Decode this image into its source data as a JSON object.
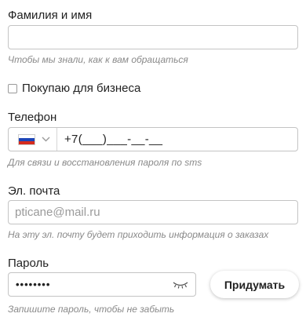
{
  "name_field": {
    "label": "Фамилия и имя",
    "value": "",
    "placeholder": "",
    "hint": "Чтобы мы знали, как к вам обращаться"
  },
  "business_checkbox": {
    "label": "Покупаю для бизнеса",
    "checked": false
  },
  "phone_field": {
    "label": "Телефон",
    "country_flag": "russia-flag-icon",
    "value": "+7(___)___-__-__",
    "hint": "Для связи и восстановления пароля по sms"
  },
  "email_field": {
    "label": "Эл. почта",
    "value": "",
    "placeholder": "pticane@mail.ru",
    "hint": "На эту эл. почту будет приходить информация о заказах"
  },
  "password_field": {
    "label": "Пароль",
    "value": "••••••••",
    "toggle_icon": "eye-closed-icon",
    "hint": "Запишите пароль, чтобы не забыть",
    "generate_button": "Придумать"
  },
  "colors": {
    "border": "#c4c4c4",
    "hint": "#8a8a8a",
    "text": "#222222"
  }
}
